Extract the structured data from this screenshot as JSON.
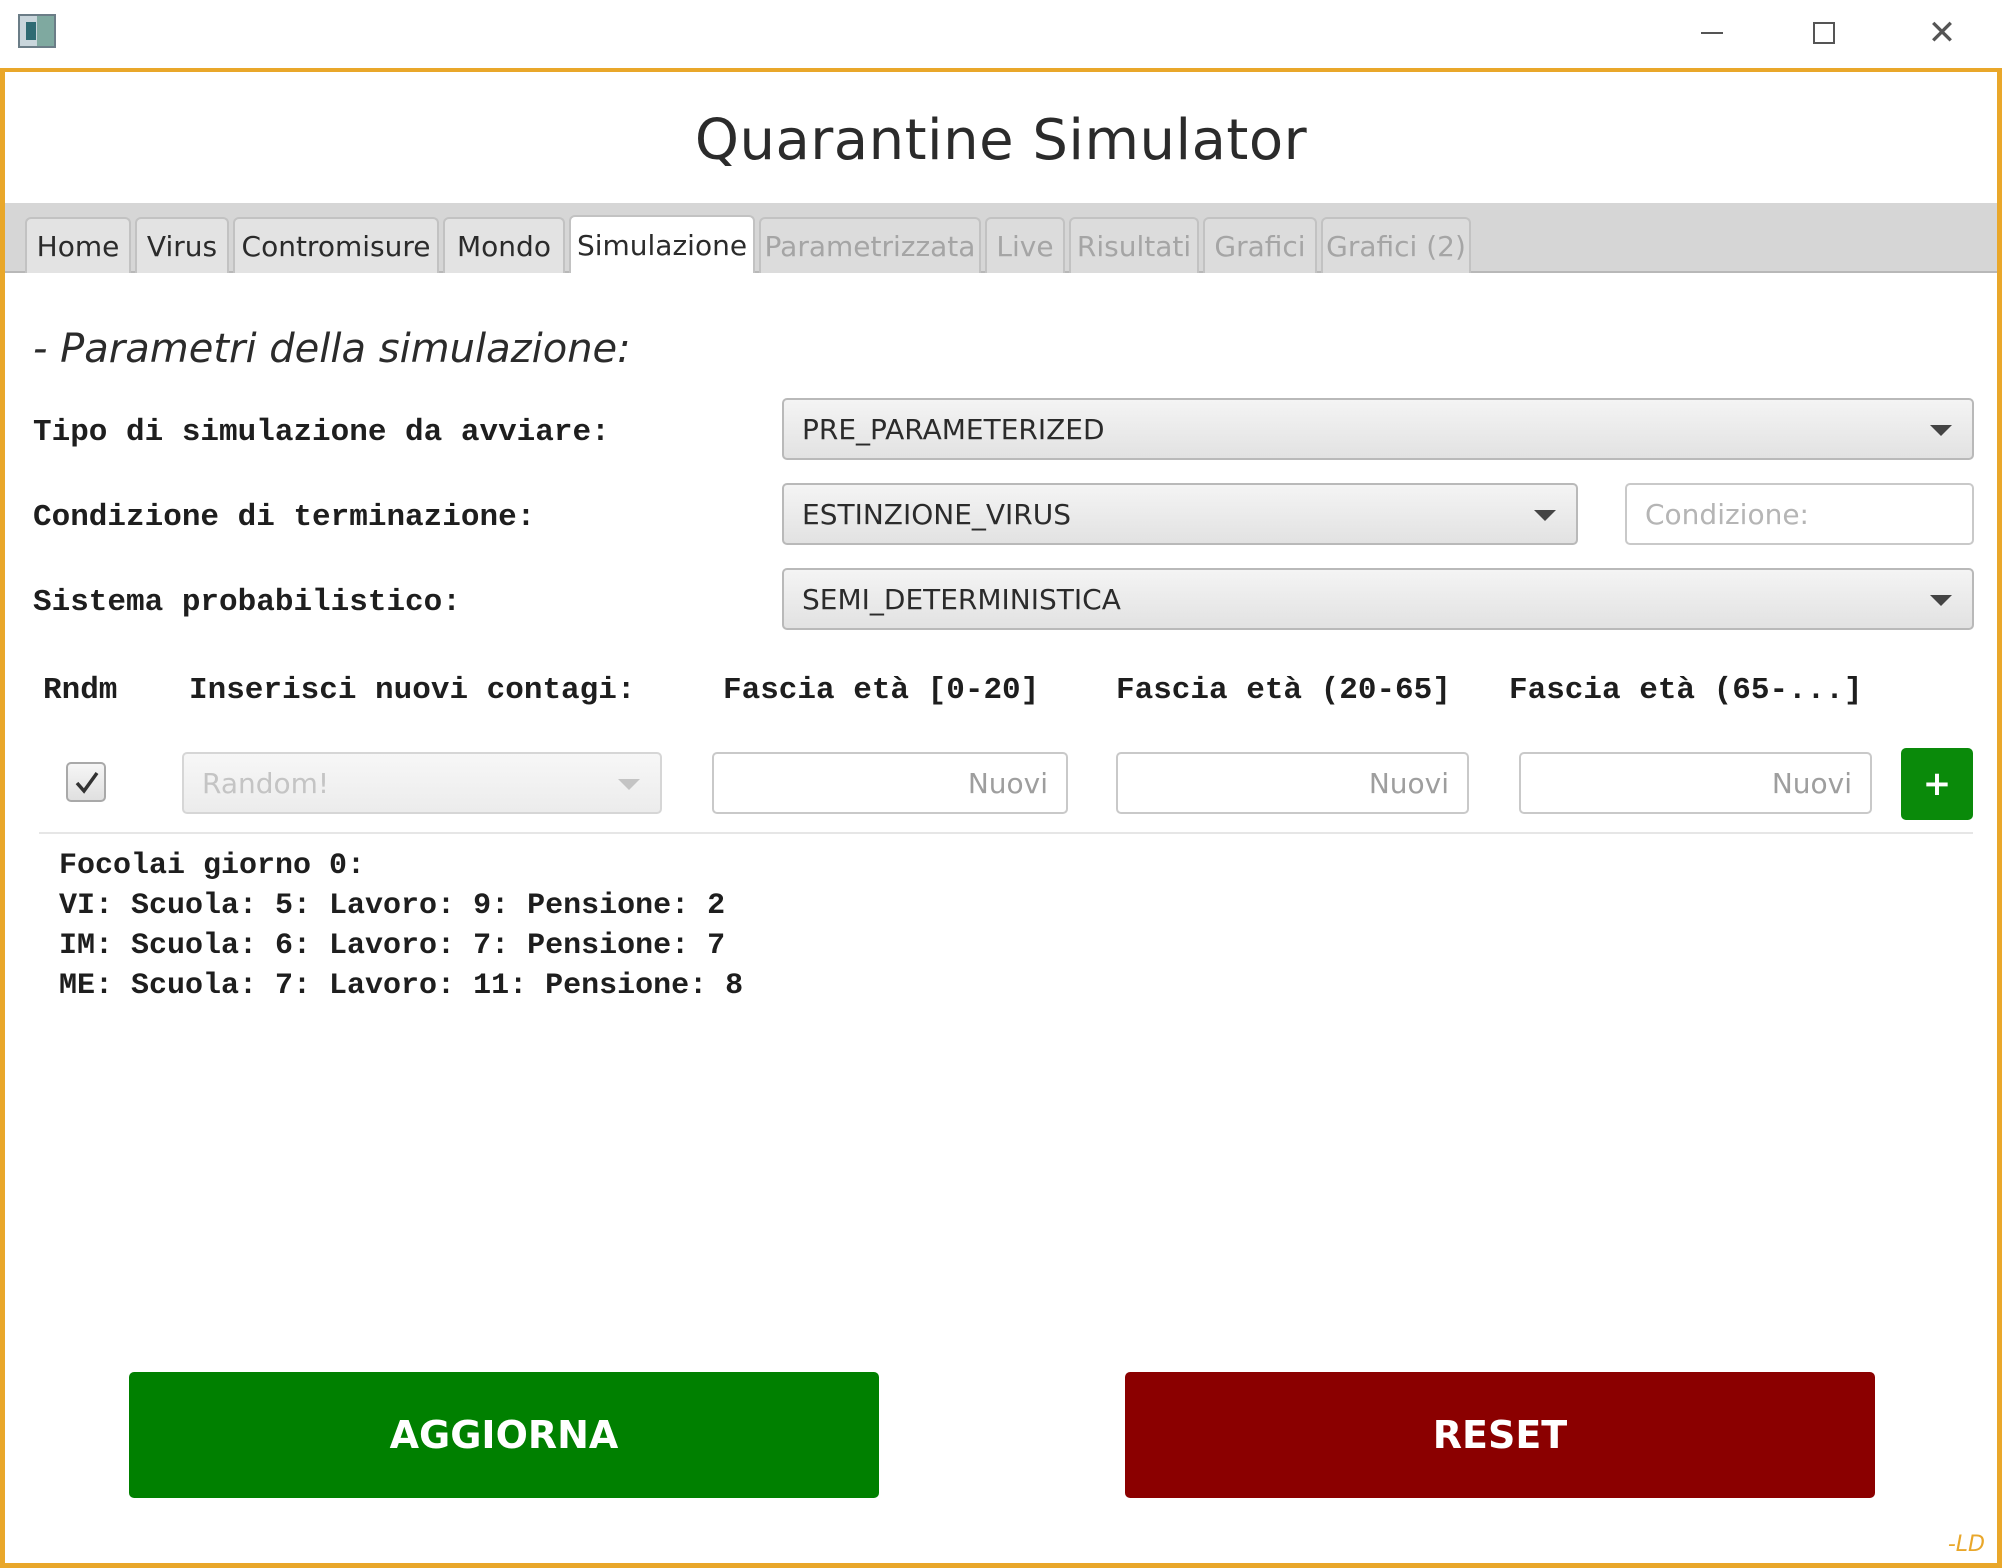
{
  "window": {
    "app_title": "Quarantine Simulator",
    "controls": {
      "minimize": "minimize-icon",
      "maximize": "maximize-icon",
      "close": "close-icon"
    }
  },
  "tabs": [
    {
      "label": "Home",
      "state": "normal"
    },
    {
      "label": "Virus",
      "state": "normal"
    },
    {
      "label": "Contromisure",
      "state": "normal"
    },
    {
      "label": "Mondo",
      "state": "normal"
    },
    {
      "label": "Simulazione",
      "state": "active"
    },
    {
      "label": "Parametrizzata",
      "state": "disabled"
    },
    {
      "label": "Live",
      "state": "disabled"
    },
    {
      "label": "Risultati",
      "state": "disabled"
    },
    {
      "label": "Grafici",
      "state": "disabled"
    },
    {
      "label": "Grafici (2)",
      "state": "disabled"
    }
  ],
  "section_title": "- Parametri della simulazione:",
  "form": {
    "tipo_label": "Tipo di simulazione da avviare:",
    "tipo_value": "PRE_PARAMETERIZED",
    "condizione_label": "Condizione di terminazione:",
    "condizione_value": "ESTINZIONE_VIRUS",
    "condizione_placeholder": "Condizione:",
    "sistema_label": "Sistema probabilistico:",
    "sistema_value": "SEMI_DETERMINISTICA"
  },
  "contagi": {
    "headers": {
      "rndm": "Rndm",
      "inserisci": "Inserisci nuovi contagi:",
      "fascia1": "Fascia età [0-20]",
      "fascia2": "Fascia età (20-65]",
      "fascia3": "Fascia età (65-...]"
    },
    "rndm_checked": true,
    "region_placeholder": "Random!",
    "input_placeholder": "Nuovi",
    "add_label": "+"
  },
  "focolai": [
    "Focolai giorno 0:",
    "VI: Scuola: 5: Lavoro: 9: Pensione: 2",
    "IM: Scuola: 6: Lavoro: 7: Pensione: 7",
    "ME: Scuola: 7: Lavoro: 11: Pensione: 8"
  ],
  "actions": {
    "update": "AGGIORNA",
    "reset": "RESET"
  },
  "signature": "-LD",
  "colors": {
    "accent_border": "#e9a72a",
    "green": "#008000",
    "red": "#8b0000"
  }
}
